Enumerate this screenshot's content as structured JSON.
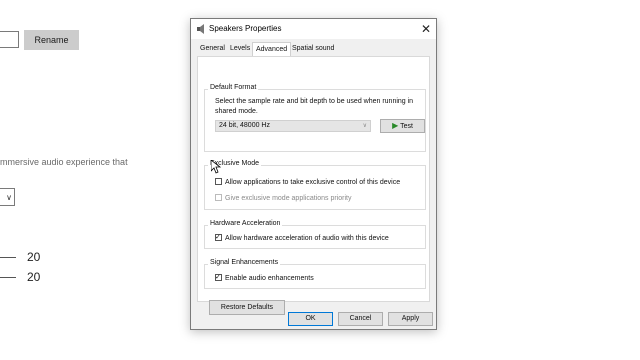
{
  "background": {
    "rename_button": "Rename",
    "description_fragment": "mmersive audio experience that",
    "dropdown_chevron": "∨",
    "slider_values": [
      "20",
      "20"
    ]
  },
  "dialog": {
    "title": "Speakers Properties",
    "close_glyph": "✕",
    "tabs": [
      {
        "label": "General",
        "active": false
      },
      {
        "label": "Levels",
        "active": false
      },
      {
        "label": "Advanced",
        "active": true
      },
      {
        "label": "Spatial sound",
        "active": false
      }
    ],
    "default_format": {
      "title": "Default Format",
      "description": "Select the sample rate and bit depth to be used when running in shared mode.",
      "selected_format": "24 bit, 48000 Hz",
      "test_button": "Test"
    },
    "exclusive_mode": {
      "title": "Exclusive Mode",
      "allow_exclusive": {
        "label": "Allow applications to take exclusive control of this device",
        "checked": false
      },
      "give_priority": {
        "label": "Give exclusive mode applications priority",
        "checked": false,
        "disabled": true
      }
    },
    "hardware_acceleration": {
      "title": "Hardware Acceleration",
      "allow_acceleration": {
        "label": "Allow hardware acceleration of audio with this device",
        "checked": true
      }
    },
    "signal_enhancements": {
      "title": "Signal Enhancements",
      "enable_enhancements": {
        "label": "Enable audio enhancements",
        "checked": true
      }
    },
    "restore_defaults_button": "Restore Defaults",
    "ok_button": "OK",
    "cancel_button": "Cancel",
    "apply_button": "Apply"
  },
  "colors": {
    "default_button_border": "#0078d7",
    "test_play_icon": "#2a8a2a"
  }
}
